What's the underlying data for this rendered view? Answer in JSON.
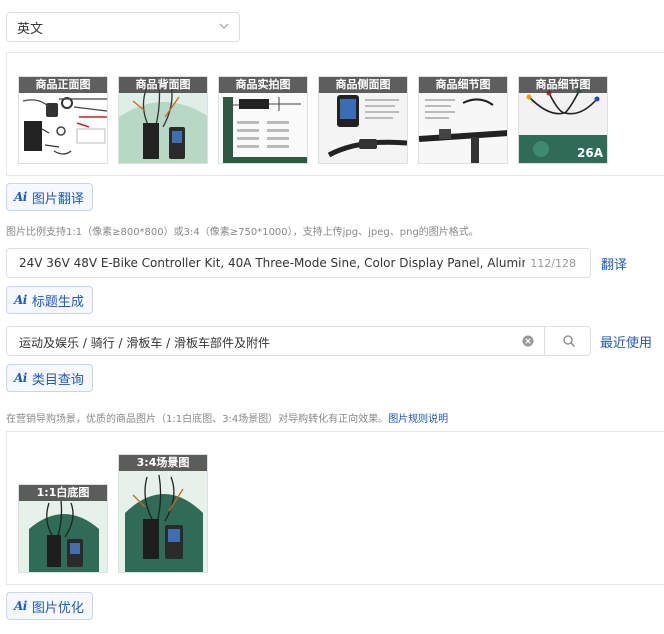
{
  "language": {
    "selected": "英文",
    "icon": "chevron-down-icon"
  },
  "product_images": [
    {
      "label": "商品正面图"
    },
    {
      "label": "商品背面图"
    },
    {
      "label": "商品实拍图"
    },
    {
      "label": "商品侧面图"
    },
    {
      "label": "商品细节图"
    },
    {
      "label": "商品细节图"
    }
  ],
  "detail_badge": "26A",
  "buttons": {
    "ai_icon": "Ai",
    "image_translate": "图片翻译",
    "title_generate": "标题生成",
    "category_query": "类目查询",
    "image_optimize": "图片优化"
  },
  "image_hint": "图片比例支持1:1（像素≥800*800）或3:4（像素≥750*1000），支持上传jpg、jpeg、png的图片格式。",
  "title_field": {
    "value": "24V 36V 48V E-Bike Controller Kit, 40A Three-Mode Sine, Color Display Panel, Aluminum All",
    "count": "112/128",
    "translate_link": "翻译"
  },
  "category_field": {
    "value": "运动及娱乐 / 骑行 / 滑板车 / 滑板车部件及附件",
    "clear_icon": "clear-circle-icon",
    "search_icon": "search-icon",
    "recent_link": "最近使用"
  },
  "scene_hint": {
    "text": "在营销导购场景，优质的商品图片（1:1白底图、3:4场景图）对导购转化有正向效果。",
    "link": "图片规则说明"
  },
  "scene_images": [
    {
      "label": "1:1白底图"
    },
    {
      "label": "3:4场景图"
    }
  ],
  "colors": {
    "accent": "#1f59c4",
    "border": "#dcdfe6",
    "label_bg": "#3c3c3c",
    "scene_green": "#2f6b57"
  }
}
